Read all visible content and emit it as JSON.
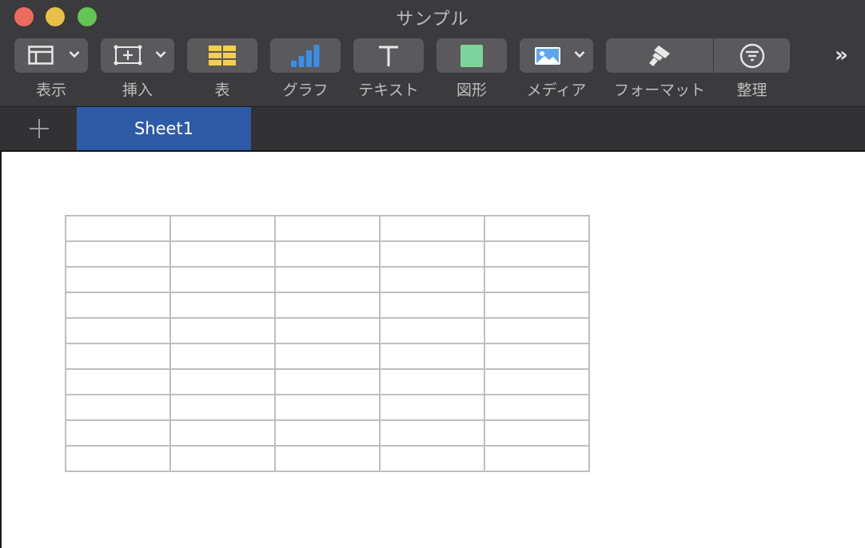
{
  "window": {
    "title": "サンプル"
  },
  "toolbar": {
    "items": [
      {
        "label": "表示",
        "icon": "sidebar-view-icon"
      },
      {
        "label": "挿入",
        "icon": "insert-icon"
      },
      {
        "label": "表",
        "icon": "table-icon"
      },
      {
        "label": "グラフ",
        "icon": "chart-icon"
      },
      {
        "label": "テキスト",
        "icon": "text-icon"
      },
      {
        "label": "図形",
        "icon": "shape-icon"
      },
      {
        "label": "メディア",
        "icon": "media-icon"
      },
      {
        "label": "フォーマット",
        "icon": "format-brush-icon"
      },
      {
        "label": "整理",
        "icon": "organize-filter-icon"
      }
    ],
    "overflow": "»"
  },
  "tabs": {
    "add_icon": "plus-icon",
    "active": "Sheet1"
  },
  "sheet": {
    "rows": 10,
    "cols": 5
  },
  "colors": {
    "toolbar_bg": "#3b3a3c",
    "button_bg": "#5a595b",
    "tab_active": "#2e5ba6",
    "table_icon": "#f5cf4a",
    "chart_icon": "#3b8ee8",
    "shape_icon": "#7dd49a"
  }
}
